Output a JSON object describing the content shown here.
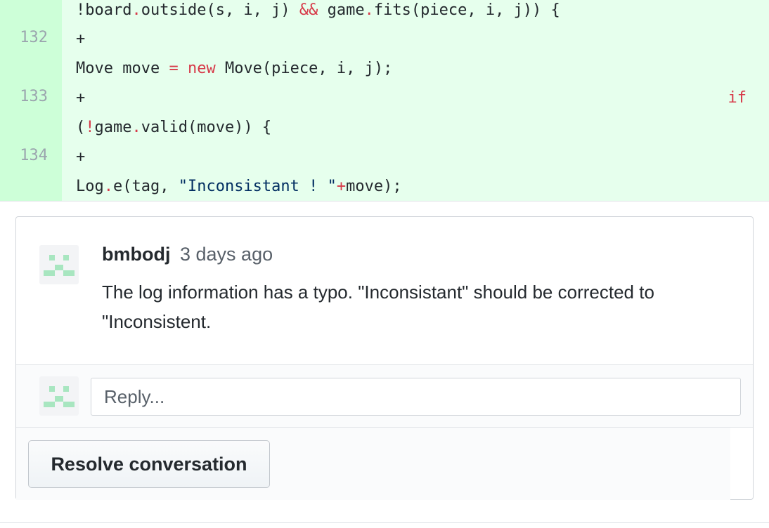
{
  "diff": {
    "line_0": {
      "prefix": "!board",
      "dot1": ".",
      "middle": "outside(s, i, j) ",
      "op": "&&",
      "space": " game",
      "dot2": ".",
      "rest": "fits(piece, i, j)) {"
    },
    "lines": [
      {
        "number": "132",
        "marker": "+"
      },
      {
        "number": "133",
        "marker": "+"
      },
      {
        "number": "134",
        "marker": "+"
      }
    ],
    "line_move": {
      "a": "Move move ",
      "eq": "=",
      "sp": " ",
      "new_kw": "new",
      "b": " Move(piece, i, j);"
    },
    "if_kw": "if",
    "line_valid": {
      "open": "(",
      "bang": "!",
      "game": "game",
      "dot": ".",
      "rest": "valid(move)) {"
    },
    "line_log": {
      "log": "Log",
      "dot": ".",
      "call": "e(tag, ",
      "str": "\"Inconsistant ! \"",
      "plus": "+",
      "rest": "move);"
    }
  },
  "comment": {
    "author": "bmbodj",
    "time": "3 days ago",
    "body": "The log information has a typo. \"Inconsistant\" should be corrected to \"Inconsistent."
  },
  "reply": {
    "placeholder": "Reply..."
  },
  "actions": {
    "resolve_label": "Resolve conversation"
  }
}
